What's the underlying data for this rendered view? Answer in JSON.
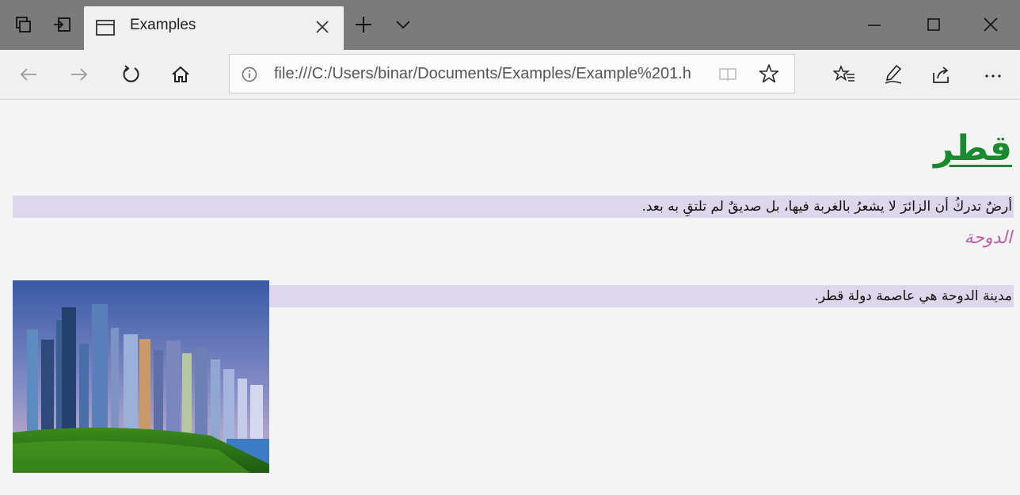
{
  "browser": {
    "tab_title": "Examples",
    "url": "file:///C:/Users/binar/Documents/Examples/Example%201.h"
  },
  "page": {
    "heading": "قطر",
    "paragraph1": "أرضٌ تدركُ أن الزائرَ لا يشعرُ بالغربة فيها، بل صديقٌ لم تلتقِ به بعد.",
    "subheading": "الدوحة",
    "paragraph2": "مدينة الدوحة هي عاصمة دولة قطر."
  },
  "colors": {
    "heading": "#1a8a2e",
    "subheading": "#c05ea4",
    "paragraph_highlight": "#dcd7ea"
  },
  "icons": [
    "tab-actions-icon",
    "set-aside-tabs-icon",
    "tab-page-icon",
    "close-tab-icon",
    "new-tab-icon",
    "tab-list-icon",
    "minimize-icon",
    "maximize-icon",
    "close-window-icon",
    "back-icon",
    "forward-icon",
    "refresh-icon",
    "home-icon",
    "info-icon",
    "reading-view-icon",
    "favorite-star-icon",
    "favorites-hub-icon",
    "web-note-icon",
    "share-icon",
    "more-icon"
  ]
}
